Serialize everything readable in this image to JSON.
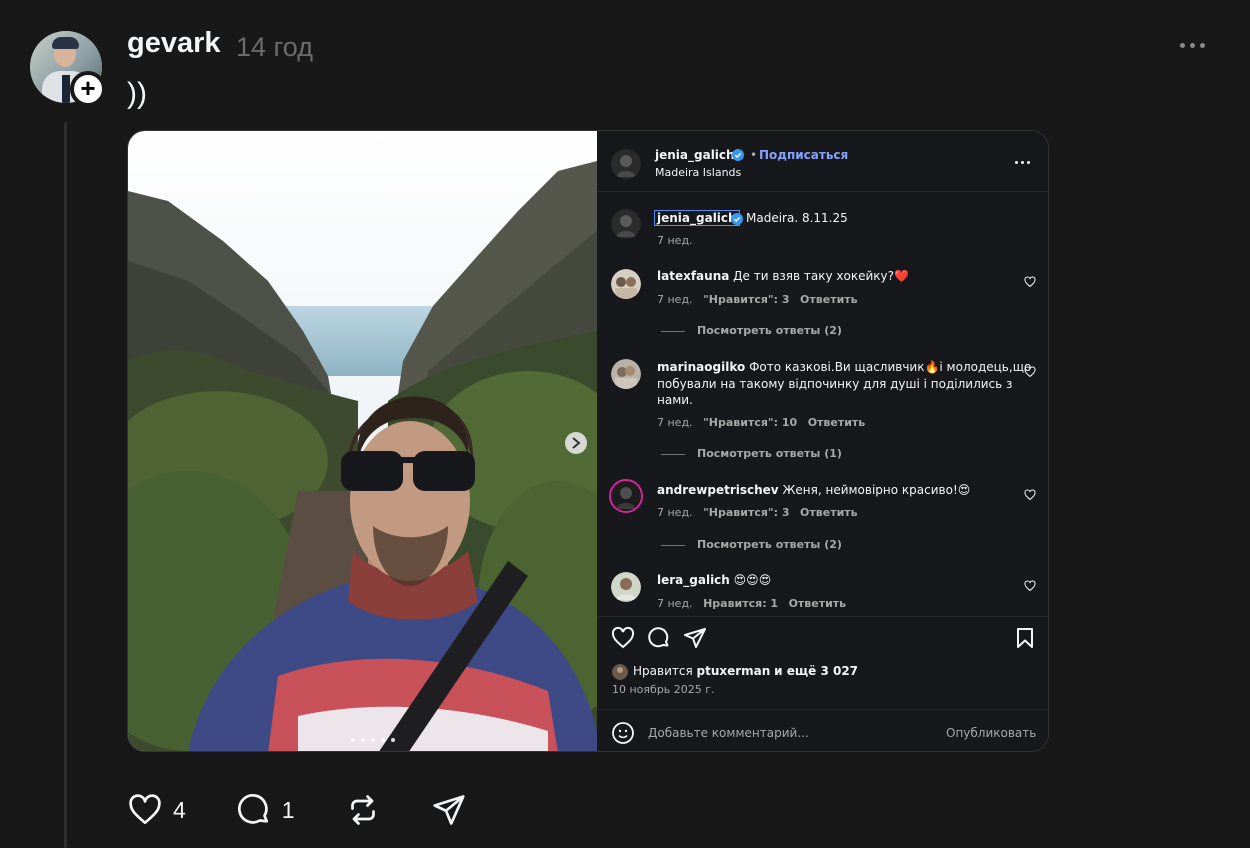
{
  "post": {
    "username": "gevark",
    "time": "14 год",
    "text": "))",
    "follow_symbol": "+"
  },
  "embed": {
    "header": {
      "username": "jenia_galich",
      "follow_label": "Подписаться",
      "location": "Madeira Islands"
    },
    "caption": {
      "username": "jenia_galich",
      "text": "Madeira. 8.11.25",
      "age": "7 нед."
    },
    "comments": [
      {
        "username": "latexfauna",
        "text_lines": [
          "Де ти взяв таку хокейку?❤️"
        ],
        "age": "7 нед.",
        "likes": "\"Нравится\": 3",
        "reply": "Ответить",
        "view_replies": "Посмотреть ответы (2)"
      },
      {
        "username": "marinaogilko",
        "text_lines": [
          "Фото казкові.Ви щасливчик🔥і молодець,що",
          "побували на такому відпочинку для душі і поділились з",
          "нами."
        ],
        "age": "7 нед.",
        "likes": "\"Нравится\": 10",
        "reply": "Ответить",
        "view_replies": "Посмотреть ответы (1)"
      },
      {
        "username": "andrewpetrischev",
        "text_lines": [
          "Женя, неймовірно красиво!😍"
        ],
        "age": "7 нед.",
        "likes": "\"Нравится\": 3",
        "reply": "Ответить",
        "view_replies": "Посмотреть ответы (2)"
      },
      {
        "username": "lera_galich",
        "text_lines": [
          "😍😍😍"
        ],
        "age": "7 нед.",
        "likes": "Нравится: 1",
        "reply": "Ответить",
        "view_replies": ""
      }
    ],
    "likes_summary": {
      "prefix": "Нравится",
      "user": "ptuxerman",
      "rest": "и ещё 3 027"
    },
    "date": "10 ноябрь 2025 г.",
    "comment_placeholder": "Добавьте комментарий...",
    "publish_label": "Опубликовать",
    "verified_color": "#3897f0",
    "follow_color": "#85a1ff"
  },
  "actions": {
    "like_count": "4",
    "reply_count": "1"
  }
}
